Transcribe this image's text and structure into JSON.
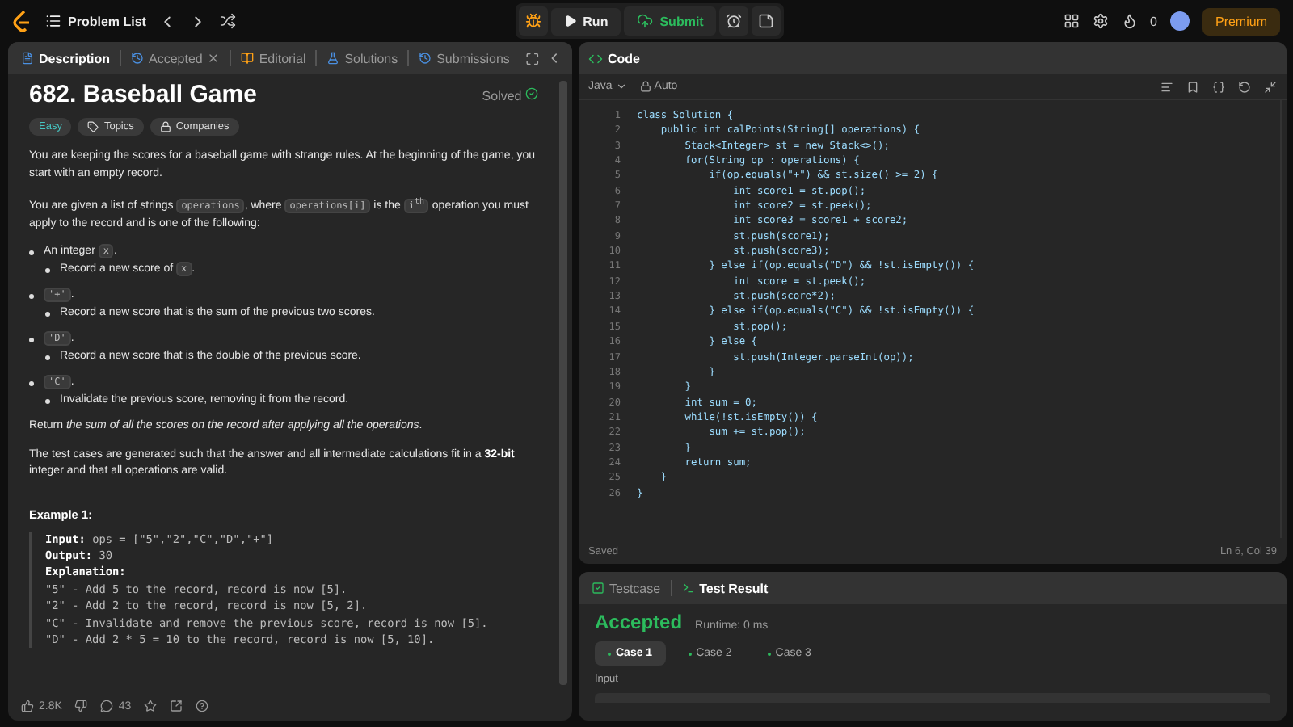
{
  "topbar": {
    "title": "Problem List",
    "run": "Run",
    "submit": "Submit",
    "streak": "0",
    "premium": "Premium"
  },
  "left_tabs": [
    {
      "label": "Description",
      "kind": "description",
      "selected": true
    },
    {
      "label": "Accepted",
      "kind": "accepted",
      "selected": false
    },
    {
      "label": "Editorial",
      "kind": "editorial",
      "selected": false
    },
    {
      "label": "Solutions",
      "kind": "solutions",
      "selected": false
    },
    {
      "label": "Submissions",
      "kind": "submissions",
      "selected": false
    }
  ],
  "problem": {
    "title": "682. Baseball Game",
    "status": "Solved",
    "tags": [
      {
        "label": "Easy",
        "kind": "difficulty"
      },
      {
        "label": "Topics",
        "kind": "topics"
      },
      {
        "label": "Companies",
        "kind": "companies"
      }
    ],
    "description": [
      {
        "kind": "para",
        "segments": [
          {
            "kind": "text",
            "text": "You are keeping the scores for a baseball game with strange rules. At the beginning of the game, you start with an empty record."
          }
        ]
      },
      {
        "kind": "para",
        "segments": [
          {
            "kind": "text",
            "text": "You are given a list of strings "
          },
          {
            "kind": "code",
            "text": "operations"
          },
          {
            "kind": "text",
            "text": ", where "
          },
          {
            "kind": "code",
            "text": "operations[i]"
          },
          {
            "kind": "text",
            "text": " is the "
          },
          {
            "kind": "code",
            "text": "i$^{th}$"
          },
          {
            "kind": "text",
            "text": " operation you must apply to the record and is one of the following:"
          }
        ]
      },
      {
        "kind": "bullet",
        "segments": [
          {
            "kind": "text",
            "text": "An integer "
          },
          {
            "kind": "code",
            "text": "x"
          },
          {
            "kind": "text",
            "text": "."
          }
        ],
        "children": [
          {
            "segments": [
              {
                "kind": "text",
                "text": "Record a new score of "
              },
              {
                "kind": "code",
                "text": "x"
              },
              {
                "kind": "text",
                "text": "."
              }
            ]
          }
        ]
      },
      {
        "kind": "bullet",
        "segments": [
          {
            "kind": "code",
            "text": "'+'"
          },
          {
            "kind": "text",
            "text": "."
          }
        ],
        "children": [
          {
            "segments": [
              {
                "kind": "text",
                "text": "Record a new score that is the sum of the previous two scores."
              }
            ]
          }
        ]
      },
      {
        "kind": "bullet",
        "segments": [
          {
            "kind": "code",
            "text": "'D'"
          },
          {
            "kind": "text",
            "text": "."
          }
        ],
        "children": [
          {
            "segments": [
              {
                "kind": "text",
                "text": "Record a new score that is the double of the previous score."
              }
            ]
          }
        ]
      },
      {
        "kind": "bullet",
        "segments": [
          {
            "kind": "code",
            "text": "'C'"
          },
          {
            "kind": "text",
            "text": "."
          }
        ],
        "children": [
          {
            "segments": [
              {
                "kind": "text",
                "text": "Invalidate the previous score, removing it from the record."
              }
            ]
          }
        ]
      },
      {
        "kind": "para",
        "segments": [
          {
            "kind": "text",
            "text": "Return "
          },
          {
            "kind": "italic",
            "text": "the sum of all the scores on the record after applying all the operations"
          },
          {
            "kind": "text",
            "text": "."
          }
        ]
      },
      {
        "kind": "para",
        "segments": [
          {
            "kind": "text",
            "text": "The test cases are generated such that the answer and all intermediate calculations fit in a "
          },
          {
            "kind": "bold",
            "text": "32-bit"
          },
          {
            "kind": "text",
            "text": " integer and that all operations are valid."
          }
        ]
      }
    ],
    "example": {
      "title": "Example 1:",
      "lines": [
        {
          "label": "Input:",
          "text": "ops = [\"5\",\"2\",\"C\",\"D\",\"+\"]"
        },
        {
          "label": "Output:",
          "text": "30"
        },
        {
          "label": "Explanation:"
        },
        {
          "text": "\"5\" - Add 5 to the record, record is now [5]."
        },
        {
          "text": "\"2\" - Add 2 to the record, record is now [5, 2]."
        },
        {
          "text": "\"C\" - Invalidate and remove the previous score, record is now [5]."
        },
        {
          "text": "\"D\" - Add 2 * 5 = 10 to the record, record is now [5, 10]."
        }
      ]
    },
    "footer": {
      "likes": "2.8K",
      "comments": "43"
    }
  },
  "code_panel": {
    "title": "Code",
    "language": "Java",
    "mode": "Auto",
    "status": "Saved",
    "position": "Ln 6, Col 39",
    "lines": [
      "class Solution {",
      "    public int calPoints(String[] operations) {",
      "        Stack<Integer> st = new Stack<>();",
      "        for(String op : operations) {",
      "            if(op.equals(\"+\") && st.size() >= 2) {",
      "                int score1 = st.pop();",
      "                int score2 = st.peek();",
      "                int score3 = score1 + score2;",
      "                st.push(score1);",
      "                st.push(score3);",
      "            } else if(op.equals(\"D\") && !st.isEmpty()) {",
      "                int score = st.peek();",
      "                st.push(score*2);",
      "            } else if(op.equals(\"C\") && !st.isEmpty()) {",
      "                st.pop();",
      "            } else {",
      "                st.push(Integer.parseInt(op));",
      "            }",
      "        }",
      "        int sum = 0;",
      "        while(!st.isEmpty()) {",
      "            sum += st.pop();",
      "        }",
      "        return sum;",
      "    }",
      "}"
    ],
    "line_numbers": [
      "1",
      "2",
      "3",
      "4",
      "5",
      "6",
      "7",
      "8",
      "9",
      "10",
      "11",
      "12",
      "13",
      "14",
      "15",
      "16",
      "17",
      "18",
      "19",
      "20",
      "21",
      "22",
      "23",
      "24",
      "25",
      "26"
    ]
  },
  "result_panel": {
    "tabs": [
      {
        "label": "Testcase",
        "kind": "testcase",
        "selected": false
      },
      {
        "label": "Test Result",
        "kind": "result",
        "selected": true
      }
    ],
    "verdict": "Accepted",
    "runtime": "Runtime: 0 ms",
    "cases": [
      {
        "label": "Case 1",
        "selected": true
      },
      {
        "label": "Case 2",
        "selected": false
      },
      {
        "label": "Case 3",
        "selected": false
      }
    ],
    "input_label": "Input"
  }
}
